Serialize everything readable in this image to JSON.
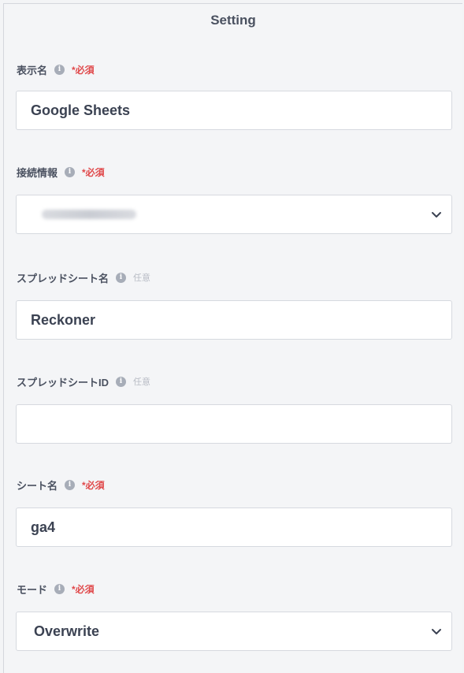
{
  "header": {
    "title": "Setting"
  },
  "fields": {
    "display_name": {
      "label": "表示名",
      "badge": "*必須",
      "value": "Google Sheets"
    },
    "connection": {
      "label": "接続情報",
      "badge": "*必須",
      "value_redacted": true
    },
    "spreadsheet_name": {
      "label": "スプレッドシート名",
      "badge": "任意",
      "value": "Reckoner"
    },
    "spreadsheet_id": {
      "label": "スプレッドシートID",
      "badge": "任意",
      "value": ""
    },
    "sheet_name": {
      "label": "シート名",
      "badge": "*必須",
      "value": "ga4"
    },
    "mode": {
      "label": "モード",
      "badge": "*必須",
      "value": "Overwrite"
    }
  },
  "icons": {
    "info": "info-icon",
    "dropdown": "chevron-down-icon"
  },
  "colors": {
    "required": "#e0484a",
    "optional": "#b8bcc5",
    "info_icon": "#a7adb8",
    "background": "#f4f5f7"
  }
}
